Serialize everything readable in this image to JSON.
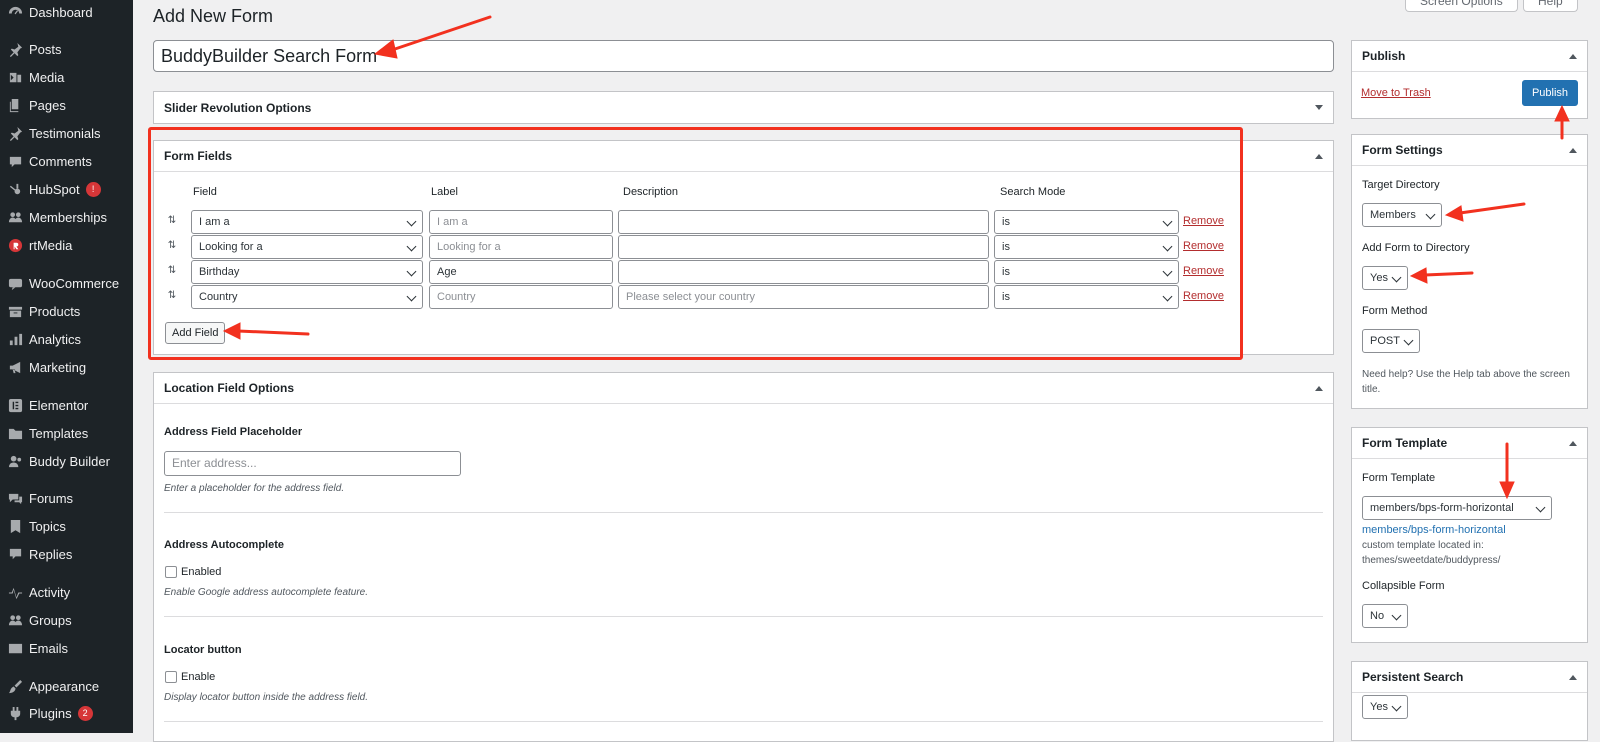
{
  "sidebar": {
    "items": [
      {
        "label": "Dashboard",
        "icon": "dashboard-icon"
      },
      {
        "label": "Posts",
        "icon": "pin-icon"
      },
      {
        "label": "Media",
        "icon": "media-icon"
      },
      {
        "label": "Pages",
        "icon": "pages-icon"
      },
      {
        "label": "Testimonials",
        "icon": "pin-icon"
      },
      {
        "label": "Comments",
        "icon": "comment-icon"
      },
      {
        "label": "HubSpot",
        "icon": "hubspot-icon",
        "badge": "!"
      },
      {
        "label": "Memberships",
        "icon": "groups-icon"
      },
      {
        "label": "rtMedia",
        "icon": "rtmedia-icon"
      },
      {
        "label": "WooCommerce",
        "icon": "woo-icon"
      },
      {
        "label": "Products",
        "icon": "archive-icon"
      },
      {
        "label": "Analytics",
        "icon": "chart-bar-icon"
      },
      {
        "label": "Marketing",
        "icon": "megaphone-icon"
      },
      {
        "label": "Elementor",
        "icon": "elementor-icon"
      },
      {
        "label": "Templates",
        "icon": "folder-icon"
      },
      {
        "label": "Buddy Builder",
        "icon": "users-icon"
      },
      {
        "label": "Forums",
        "icon": "forums-icon"
      },
      {
        "label": "Topics",
        "icon": "topics-icon"
      },
      {
        "label": "Replies",
        "icon": "replies-icon"
      },
      {
        "label": "Activity",
        "icon": "activity-icon"
      },
      {
        "label": "Groups",
        "icon": "groups-icon"
      },
      {
        "label": "Emails",
        "icon": "email-icon"
      },
      {
        "label": "Appearance",
        "icon": "brush-icon"
      },
      {
        "label": "Plugins",
        "icon": "plugin-icon",
        "badge": "2"
      }
    ]
  },
  "header": {
    "title": "Add New Form",
    "screen_options": "Screen Options",
    "help": "Help"
  },
  "form_title": "BuddyBuilder Search Form",
  "slider_box": {
    "title": "Slider Revolution Options"
  },
  "form_fields": {
    "title": "Form Fields",
    "columns": [
      "Field",
      "Label",
      "Description",
      "Search Mode"
    ],
    "rows": [
      {
        "field": "I am a",
        "label": "",
        "label_placeholder": "I am a",
        "description": "",
        "description_placeholder": "",
        "mode": "is",
        "remove": "Remove"
      },
      {
        "field": "Looking for a",
        "label": "",
        "label_placeholder": "Looking for a",
        "description": "",
        "description_placeholder": "",
        "mode": "is",
        "remove": "Remove"
      },
      {
        "field": "Birthday",
        "label": "Age",
        "label_placeholder": "",
        "description": "",
        "description_placeholder": "",
        "mode": "is",
        "remove": "Remove"
      },
      {
        "field": "Country",
        "label": "",
        "label_placeholder": "Country",
        "description": "",
        "description_placeholder": "Please select your country",
        "mode": "is",
        "remove": "Remove"
      }
    ],
    "add_button": "Add Field"
  },
  "location": {
    "title": "Location Field Options",
    "placeholder_label": "Address Field Placeholder",
    "placeholder_input": "Enter address...",
    "placeholder_desc": "Enter a placeholder for the address field.",
    "autocomplete_label": "Address Autocomplete",
    "autocomplete_option": "Enabled",
    "autocomplete_desc": "Enable Google address autocomplete feature.",
    "locator_label": "Locator button",
    "locator_option": "Enable",
    "locator_desc": "Display locator button inside the address field."
  },
  "publish_box": {
    "title": "Publish",
    "trash": "Move to Trash",
    "button": "Publish"
  },
  "form_settings": {
    "title": "Form Settings",
    "target_label": "Target Directory",
    "target_value": "Members",
    "add_label": "Add Form to Directory",
    "add_value": "Yes",
    "method_label": "Form Method",
    "method_value": "POST",
    "help_text": "Need help? Use the Help tab above the screen title."
  },
  "form_template": {
    "title": "Form Template",
    "label": "Form Template",
    "value": "members/bps-form-horizontal",
    "link": "members/bps-form-horizontal",
    "note": "custom template located in: themes/sweetdate/buddypress/",
    "collapsible_label": "Collapsible Form",
    "collapsible_value": "No"
  },
  "persistent": {
    "title": "Persistent Search",
    "value": "Yes"
  },
  "colors": {
    "sidebar_bg": "#1d2327",
    "accent": "#2271b1",
    "annotation": "#f2311f",
    "danger": "#b32d2e"
  }
}
